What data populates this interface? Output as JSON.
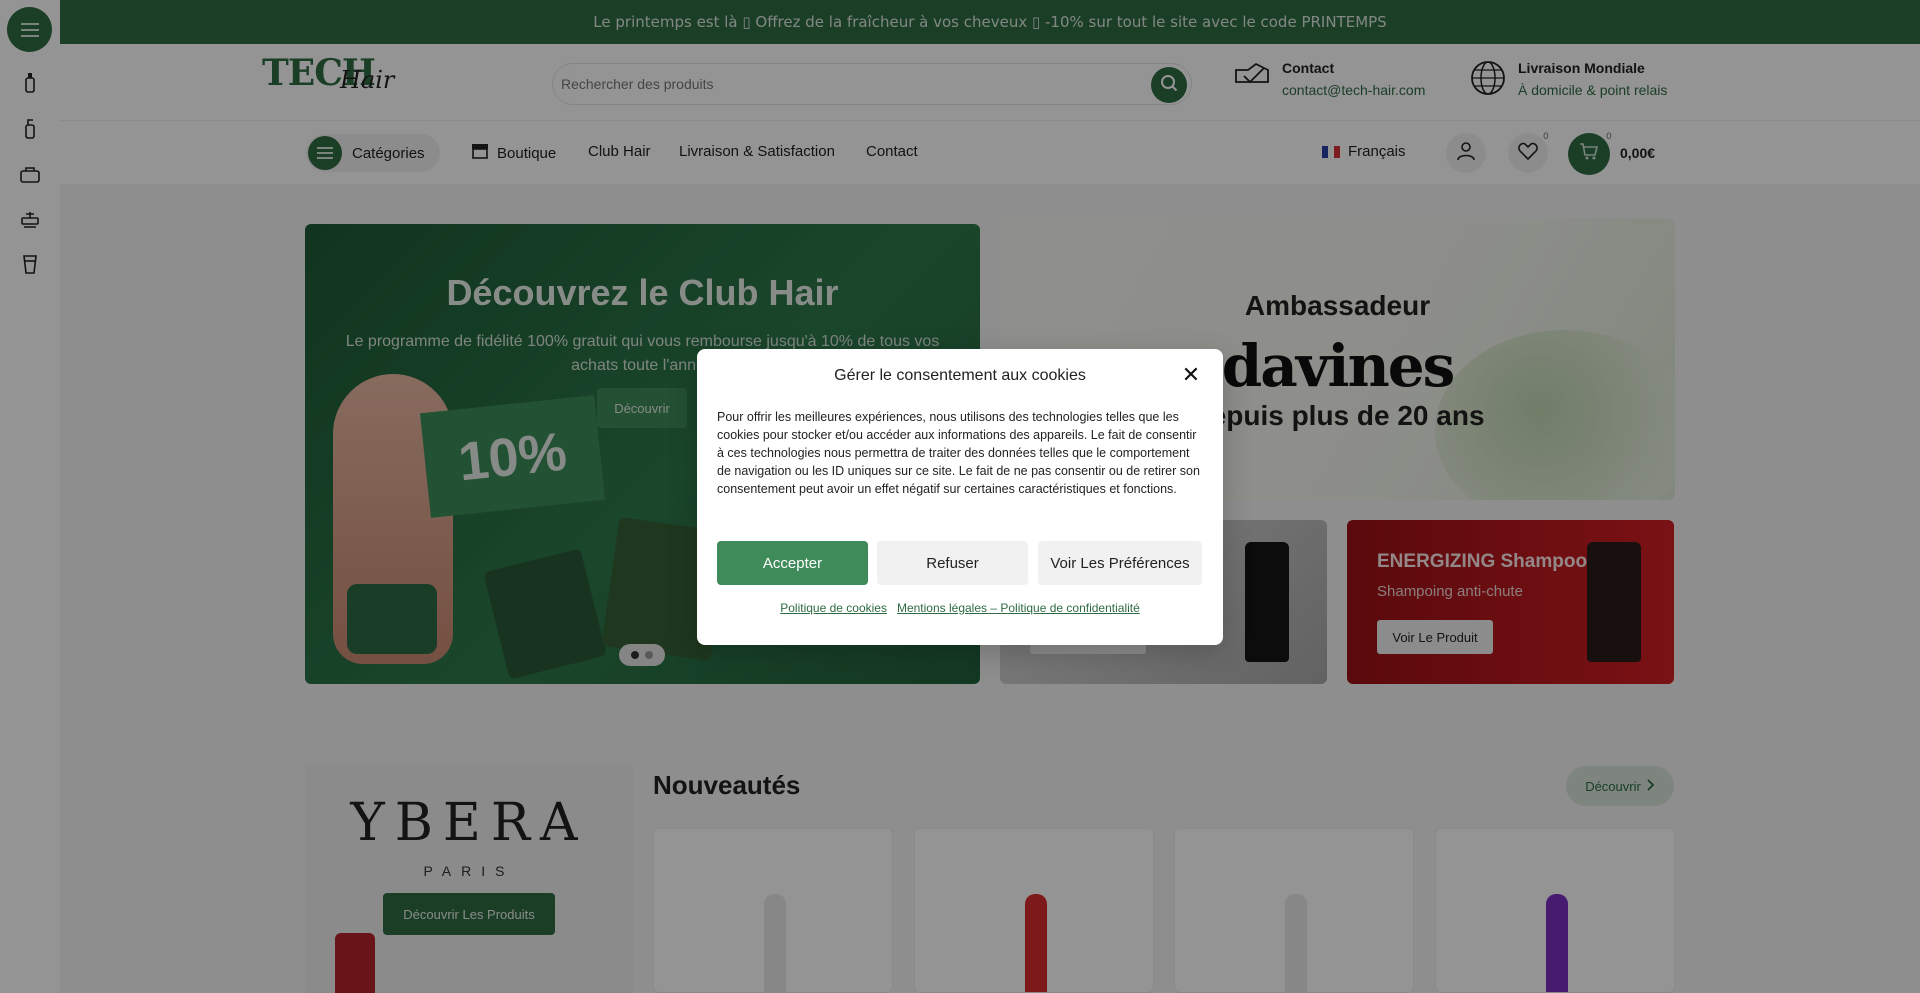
{
  "promo_bar": {
    "text": "Le printemps est là ▯ Offrez de la fraîcheur à vos cheveux ▯ -10% sur tout le site avec le code PRINTEMPS"
  },
  "sidebar_rail": {
    "icons": [
      "menu-icon",
      "spray-bottle-icon",
      "dropper-icon",
      "bag-icon",
      "barber-chair-icon",
      "cup-icon"
    ]
  },
  "header": {
    "logo_primary": "TECH",
    "logo_secondary": "Hair",
    "search_placeholder": "Rechercher des produits",
    "contact_title": "Contact",
    "contact_email": "contact@tech-hair.com",
    "shipping_title": "Livraison Mondiale",
    "shipping_sub": "À domicile & point relais"
  },
  "nav": {
    "categories": "Catégories",
    "links": [
      "Boutique",
      "Club Hair",
      "Livraison & Satisfaction",
      "Contact"
    ],
    "language": "Français",
    "wishlist_count": "0",
    "cart_count": "0",
    "cart_total": "0,00€"
  },
  "hero": {
    "title": "Découvrez le Club Hair",
    "text": "Le programme de fidélité 100% gratuit qui vous rembourse jusqu'à 10% de tous vos achats toute l'année",
    "button": "Découvrir",
    "tag": "10%",
    "slide_index": 1,
    "slide_total": 2
  },
  "ambassador": {
    "title": "Ambassadeur",
    "brand": "davines",
    "since": "Depuis plus de 20 ans"
  },
  "product_cards": [
    {
      "title": "",
      "subtitle": "",
      "button": ""
    },
    {
      "title": "ENERGIZING Shampoo",
      "subtitle": "Shampoing anti-chute",
      "button": "Voir Le Produit"
    }
  ],
  "ybera": {
    "logo": "YBERA",
    "sub": "PARIS",
    "button": "Découvrir Les Produits"
  },
  "new_section": {
    "title": "Nouveautés",
    "button": "Découvrir"
  },
  "cookie_modal": {
    "title": "Gérer le consentement aux cookies",
    "body": "Pour offrir les meilleures expériences, nous utilisons des technologies telles que les cookies pour stocker et/ou accéder aux informations des appareils. Le fait de consentir à ces technologies nous permettra de traiter des données telles que le comportement de navigation ou les ID uniques sur ce site. Le fait de ne pas consentir ou de retirer son consentement peut avoir un effet négatif sur certaines caractéristiques et fonctions.",
    "accept": "Accepter",
    "refuse": "Refuser",
    "preferences": "Voir Les Préférences",
    "link_cookies": "Politique de cookies",
    "link_legal": "Mentions légales – Politique de confidentialité"
  },
  "colors": {
    "brand_green": "#2f6b43",
    "accept_green": "#3f8b5a",
    "energizing_red": "#c01d22"
  }
}
